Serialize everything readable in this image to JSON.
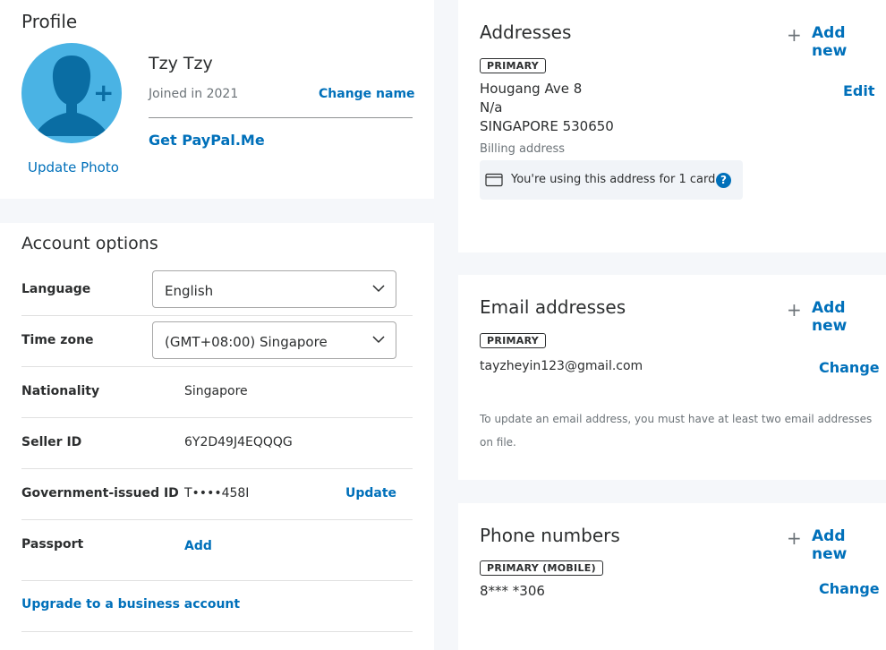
{
  "profile": {
    "title": "Profile",
    "name": "Tzy Tzy",
    "joined": "Joined in 2021",
    "change_name": "Change name",
    "paypal_me": "Get PayPal.Me",
    "update_photo": "Update Photo",
    "avatar_bg": "#4ab3e4",
    "avatar_fg": "#0a6da3"
  },
  "account": {
    "title": "Account options",
    "language_label": "Language",
    "language_value": "English",
    "timezone_label": "Time zone",
    "timezone_value": "(GMT+08:00) Singapore",
    "nationality_label": "Nationality",
    "nationality_value": "Singapore",
    "seller_label": "Seller ID",
    "seller_value": "6Y2D49J4EQQQG",
    "govid_label": "Government-issued ID",
    "govid_value": "T••••458I",
    "govid_action": "Update",
    "passport_label": "Passport",
    "passport_action": "Add",
    "upgrade": "Upgrade to a business account"
  },
  "addresses": {
    "title": "Addresses",
    "add_new": "Add new",
    "badge": "PRIMARY",
    "line1": "Hougang Ave 8",
    "line2": "N/a",
    "line3": "SINGAPORE 530650",
    "type": "Billing address",
    "edit": "Edit",
    "card_note": "You're using this address for 1 card",
    "help": "?"
  },
  "emails": {
    "title": "Email addresses",
    "add_new": "Add new",
    "badge": "PRIMARY",
    "email": "tayzheyin123@gmail.com",
    "change": "Change",
    "note": "To update an email address, you must have at least two email addresses on file."
  },
  "phones": {
    "title": "Phone numbers",
    "add_new": "Add new",
    "badge": "PRIMARY (MOBILE)",
    "phone": "8*** *306",
    "change": "Change"
  },
  "colors": {
    "link": "#0070ba",
    "text": "#2c2e2f",
    "muted": "#6c7378",
    "page_bg": "#f5f7fa"
  }
}
